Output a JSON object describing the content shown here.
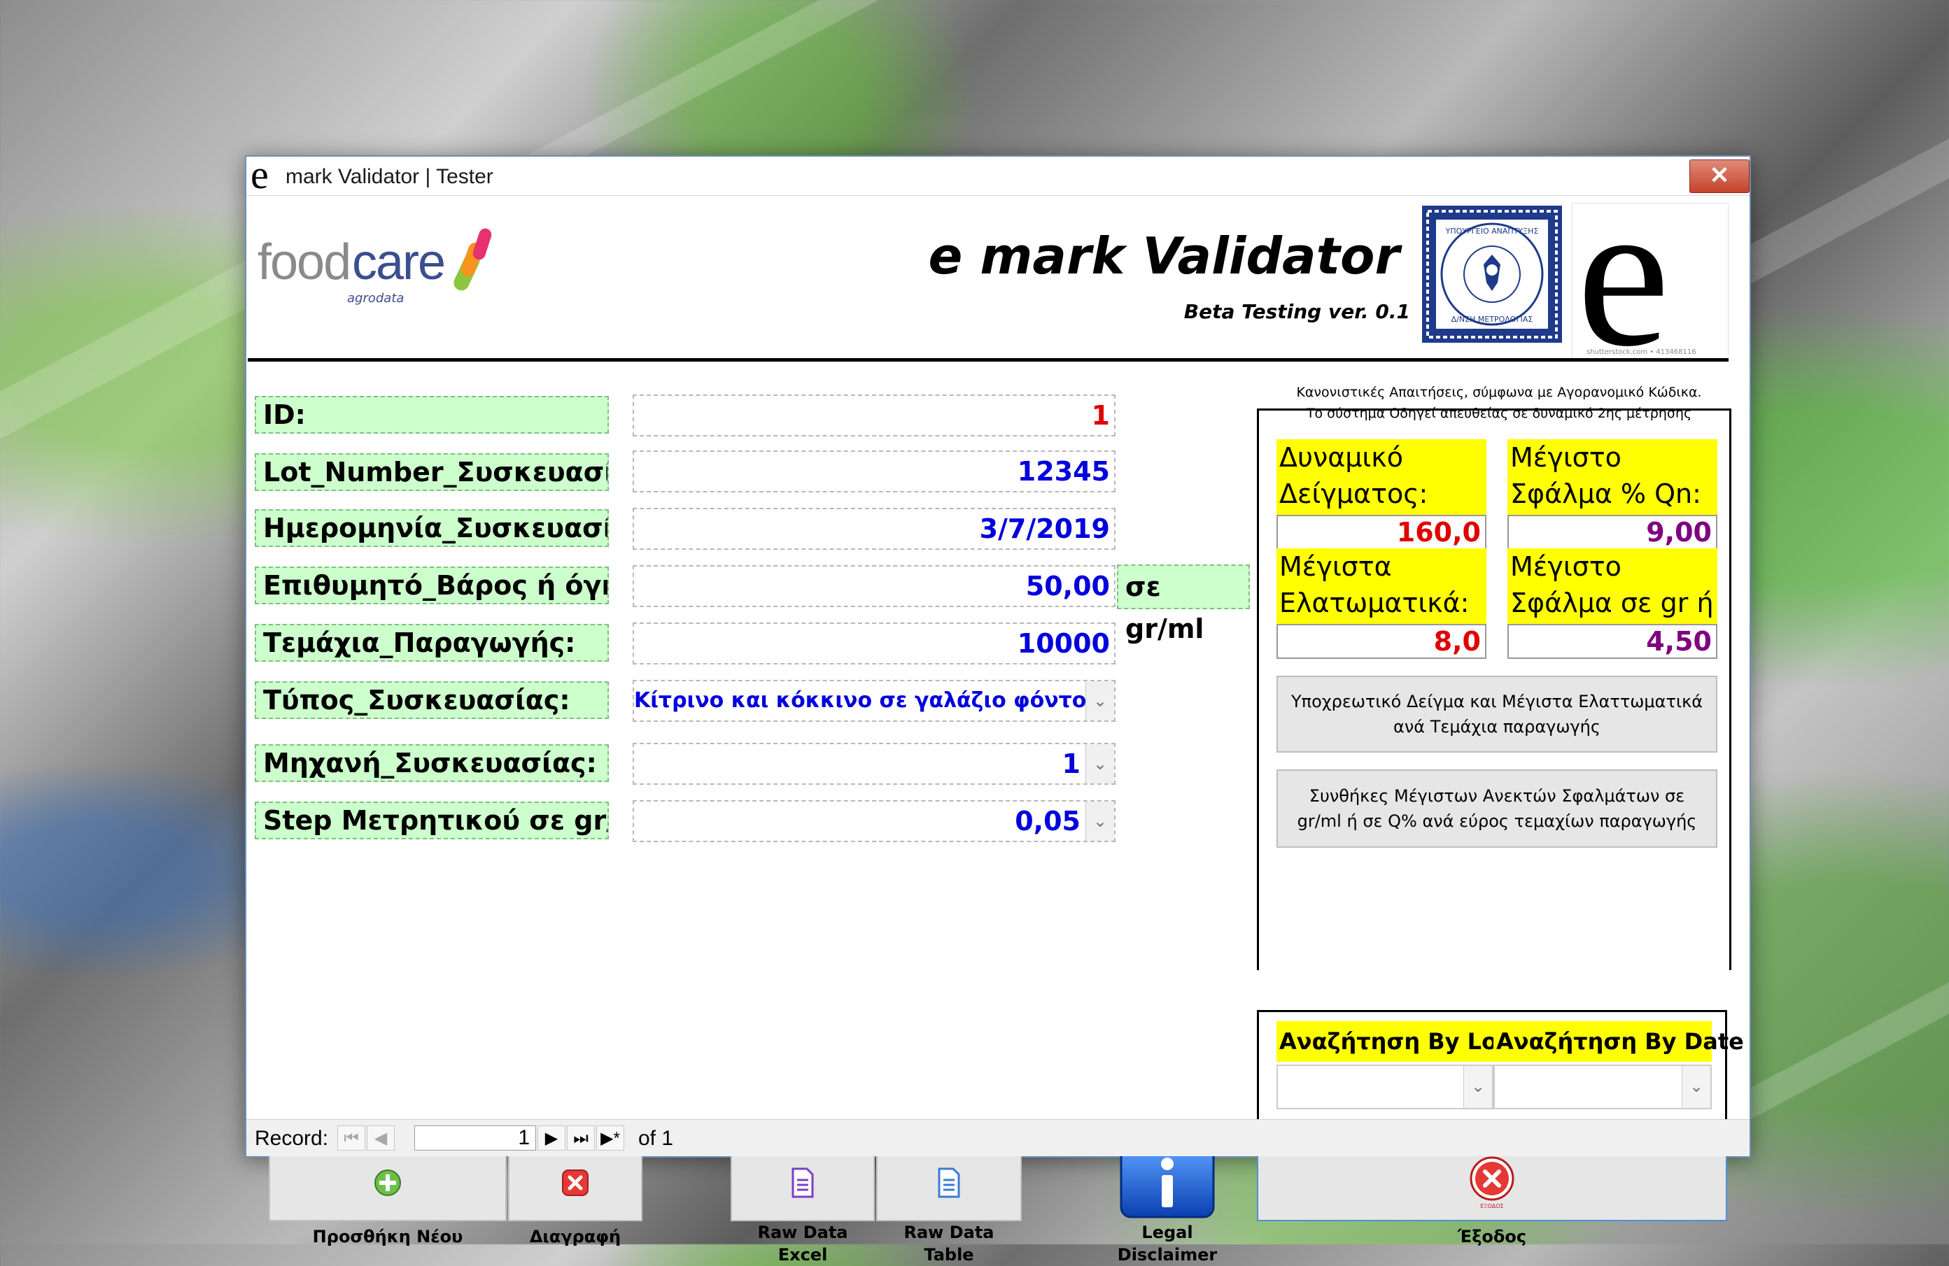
{
  "window": {
    "title": "mark Validator | Tester",
    "close_glyph": "✕"
  },
  "header": {
    "logo_text": "foodcare",
    "logo_sub": "agrodata",
    "app_title": "e mark Validator",
    "version": "Beta Testing ver. 0.1",
    "seal_text": "ΥΠΟΥΡΓΕΙΟ ΑΝΑΠΤΥΞΗΣ • Δ/ΝΣΗ ΜΕΤΡΟΛΟΓΙΑΣ • ΓΟΛΙΚΗ ΑΡΧΙΚΗ",
    "emark_caption": "shutterstock.com • 413468116"
  },
  "form": {
    "fields": [
      {
        "label": "ID:",
        "value": "1"
      },
      {
        "label": "Lot_Number_Συσκευασίας:",
        "value": "12345"
      },
      {
        "label": "Ημερομηνία_Συσκευασίας:",
        "value": "3/7/2019"
      },
      {
        "label": "Επιθυμητό_Βάρος ή όγκος:",
        "value": "50,00"
      },
      {
        "label": "Τεμάχια_Παραγωγής:",
        "value": "10000"
      },
      {
        "label": "Τύπος_Συσκευασίας:",
        "value": "Κίτρινο και κόκκινο σε γαλάζιο φόντο"
      },
      {
        "label": "Μηχανή_Συσκευασίας:",
        "value": "1"
      },
      {
        "label": "Step Μετρητικού σε gr/ml:",
        "value": "0,05"
      }
    ],
    "unit": "σε gr/ml"
  },
  "panel": {
    "note_line1": "Κανονιστικές Απαιτήσεις, σύμφωνα με Αγορανομικό Κώδικα.",
    "note_line2": "Το σύστημα Οδηγεί  απευθείας σε δυναμικό 2ης μέτρησης",
    "boxes": [
      {
        "line1": "Δυναμικό",
        "line2": "Δείγματος:",
        "value": "160,0",
        "color": "#e00000"
      },
      {
        "line1": "Μέγιστο",
        "line2": "Σφάλμα % Qn:",
        "value": "9,00",
        "color": "#800080"
      },
      {
        "line1": "Μέγιστα",
        "line2": "Ελατωματικά:",
        "value": "8,0",
        "color": "#e00000"
      },
      {
        "line1": "Μέγιστο",
        "line2": "Σφάλμα σε gr ή",
        "value": "4,50",
        "color": "#800080"
      }
    ],
    "btn_sample": "Υποχρεωτικό Δείγμα και Μέγιστα Ελαττωματικά ανά Τεμάχια παραγωγής",
    "btn_conditions": "Συνθήκες Μέγιστων Ανεκτών Σφαλμάτων σε gr/ml ή σε Q% ανά εύρος τεμαχίων παραγωγής",
    "search_lot": "Αναζήτηση By Lot",
    "search_date": "Αναζήτηση By Date",
    "search_lot_value": "",
    "search_date_value": ""
  },
  "buttons": {
    "add": "Προσθήκη Νέου",
    "delete": "Διαγραφή",
    "raw_excel_1": "Raw Data",
    "raw_excel_2": "Excel",
    "raw_table_1": "Raw Data",
    "raw_table_2": "Table",
    "legal_1": "Legal",
    "legal_2": "Disclaimer",
    "exit": "Έξοδος",
    "exit_icon_caption": "ΕΞΟΔΟΣ"
  },
  "navigator": {
    "label": "Record:",
    "current": "1",
    "of_text": "of 1",
    "icons": [
      "first-record-icon",
      "prev-record-icon",
      "next-record-icon",
      "last-record-icon",
      "new-record-icon"
    ]
  }
}
